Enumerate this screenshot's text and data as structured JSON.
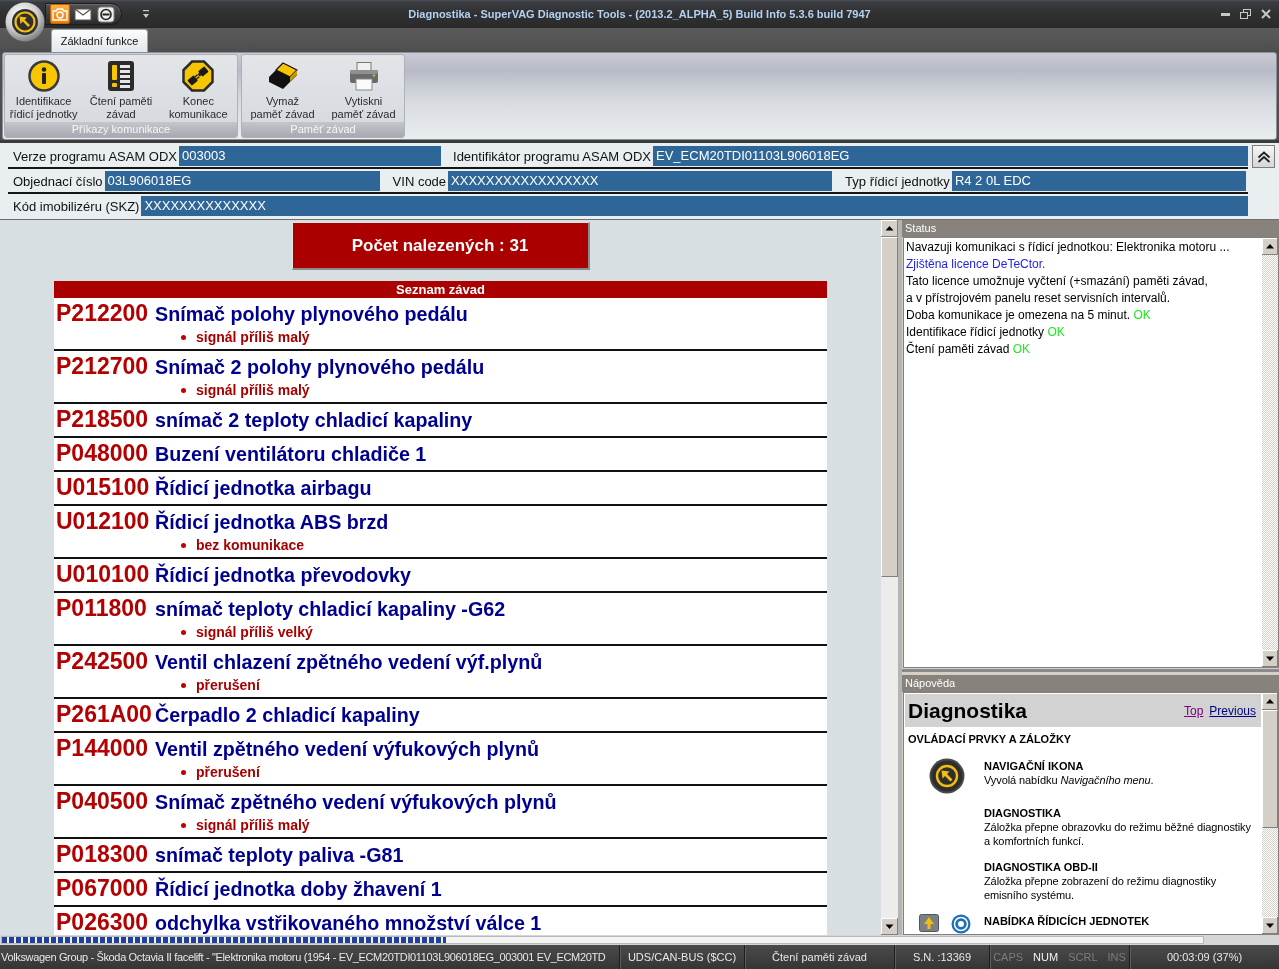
{
  "window": {
    "title": "Diagnostika - SuperVAG Diagnostic Tools - (2013.2_ALPHA_5) Build Info 5.3.6 build 7947"
  },
  "quick_access": [
    {
      "kind": "camera",
      "highlighted": true
    },
    {
      "kind": "envelope",
      "highlighted": false
    },
    {
      "kind": "disconnect",
      "highlighted": false
    }
  ],
  "ribbon": {
    "tabs": [
      {
        "label": "Základní funkce",
        "selected": true
      }
    ],
    "groups": [
      {
        "label": "Příkazy komunikace",
        "buttons": [
          {
            "kind": "info",
            "lines": [
              "Identifikace",
              "řídicí jednotky"
            ]
          },
          {
            "kind": "fault-list",
            "lines": [
              "Čtení paměti",
              "závad"
            ]
          },
          {
            "kind": "disconnect",
            "lines": [
              "Konec",
              "komunikace"
            ]
          }
        ]
      },
      {
        "label": "Paměť závad",
        "buttons": [
          {
            "kind": "eraser",
            "lines": [
              "Vymaž",
              "paměť závad"
            ]
          },
          {
            "kind": "printer",
            "lines": [
              "Vytiskni",
              "paměť závad"
            ]
          }
        ]
      }
    ]
  },
  "info_fields": [
    {
      "fields": [
        {
          "label": "Verze programu ASAM ODX",
          "value": "003003"
        },
        {
          "label": "Identifikátor programu ASAM ODX",
          "value": "EV_ECM20TDI01103L906018EG"
        }
      ]
    },
    {
      "fields": [
        {
          "label": "Objednací číslo",
          "value": "03L906018EG"
        },
        {
          "label": "VIN code",
          "value": "XXXXXXXXXXXXXXXXX"
        },
        {
          "label": "Typ řídicí jednotky",
          "value": "R4 2 0L EDC"
        }
      ]
    },
    {
      "fields": [
        {
          "label": "Kód imobilizéru (SKZ)",
          "value": "XXXXXXXXXXXXXX"
        }
      ]
    }
  ],
  "faults": {
    "count_label": "Počet nalezených : 31",
    "title": "Seznam závad",
    "items": [
      {
        "code": "P212200",
        "description": "Snímač polohy plynového pedálu",
        "details": [
          "signál příliš malý"
        ]
      },
      {
        "code": "P212700",
        "description": "Snímač 2 polohy plynového pedálu",
        "details": [
          "signál příliš malý"
        ]
      },
      {
        "code": "P218500",
        "description": "snímač 2 teploty chladicí kapaliny"
      },
      {
        "code": "P048000",
        "description": "Buzení ventilátoru chladiče 1"
      },
      {
        "code": "U015100",
        "description": "Řídicí jednotka airbagu"
      },
      {
        "code": "U012100",
        "description": "Řídicí jednotka ABS brzd",
        "details": [
          "bez komunikace"
        ]
      },
      {
        "code": "U010100",
        "description": "Řídicí jednotka převodovky"
      },
      {
        "code": "P011800",
        "description": "snímač teploty chladicí kapaliny -G62",
        "details": [
          "signál příliš velký"
        ]
      },
      {
        "code": "P242500",
        "description": "Ventil chlazení zpětného vedení výf.plynů",
        "details": [
          "přerušení"
        ]
      },
      {
        "code": "P261A00",
        "description": "Čerpadlo 2 chladicí kapaliny"
      },
      {
        "code": "P144000",
        "description": "Ventil zpětného vedení výfukových plynů",
        "details": [
          "přerušení"
        ]
      },
      {
        "code": "P040500",
        "description": "Snímač zpětného vedení výfukových plynů",
        "details": [
          "signál příliš malý"
        ]
      },
      {
        "code": "P018300",
        "description": "snímač teploty paliva -G81"
      },
      {
        "code": "P067000",
        "description": "Řídicí jednotka doby žhavení 1"
      },
      {
        "code": "P026300",
        "description": "odchylka vstřikovaného množství válce 1"
      }
    ]
  },
  "status": {
    "title": "Status",
    "lines": [
      {
        "kind": "plain",
        "text": "Navazuji komunikaci s řídicí jednotkou: Elektronika motoru ..."
      },
      {
        "kind": "notice",
        "text": "Zjištěna licence DeTeCtor."
      },
      {
        "kind": "plain",
        "text": "Tato licence umožnuje vyčtení (+smazání) paměti závad,"
      },
      {
        "kind": "plain",
        "text": "a v přístrojovém panelu reset servisních intervalů."
      },
      {
        "kind": "plain",
        "text": "Doba komunikace je omezena na 5 minut.",
        "result": "OK"
      },
      {
        "kind": "plain",
        "text": "Identifikace řídicí jednotky",
        "result": "OK"
      },
      {
        "kind": "plain",
        "text": "Čtení paměti závad",
        "result": "OK"
      }
    ]
  },
  "help": {
    "title": "Nápověda",
    "heading": "Diagnostika",
    "links": [
      {
        "label": "Top",
        "visited": true
      },
      {
        "label": "Previous",
        "visited": false
      }
    ],
    "section": "OVLÁDACÍ PRVKY A ZÁLOŽKY",
    "items": [
      {
        "kind": "navigation",
        "title": "NAVIGAČNÍ IKONA",
        "text": "Vyvolá nabídku *Navigačního menu*."
      },
      {
        "kind": "plain",
        "title": "DIAGNOSTIKA",
        "text": "Záložka přepne obrazovku do režimu běžné diagnostiky a komfortních funkcí."
      },
      {
        "kind": "plain",
        "title": "DIAGNOSTIKA OBD-II",
        "text": "Záložka přepne zobrazení do režimu diagnostiky emisního systému."
      },
      {
        "kind": "control-units",
        "title": "NABÍDKA ŘÍDICÍCH JEDNOTEK"
      }
    ]
  },
  "progress": {
    "level": 0.37
  },
  "status_bar": {
    "panes": [
      "Volkswagen Group - Škoda Octavia II facelift - \"Elektronika motoru (1954 - EV_ECM20TDI01103L906018EG_003001 EV_ECM20TD",
      "UDS/CAN-BUS ($CC)",
      "Čtení paměti závad",
      "S.N. :13369"
    ],
    "indicators": [
      {
        "label": "CAPS",
        "on": false
      },
      {
        "label": "NUM",
        "on": true
      },
      {
        "label": "SCRL",
        "on": false
      },
      {
        "label": "INS",
        "on": false
      }
    ],
    "timer": "00:03:09 (37%)"
  }
}
